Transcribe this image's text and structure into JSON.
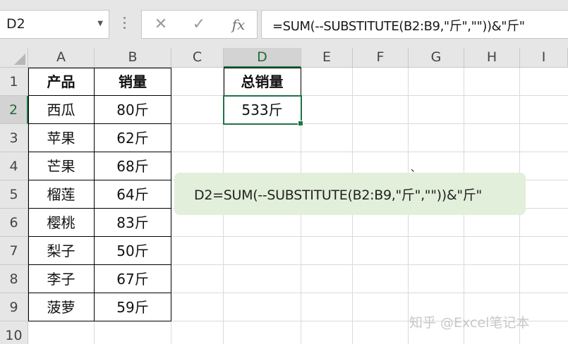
{
  "name_box": {
    "value": "D2",
    "dropdown_icon": "caret-down-icon"
  },
  "formula_bar": {
    "cancel_icon": "cross-icon",
    "enter_icon": "check-icon",
    "fx_label": "fx",
    "formula": "=SUM(--SUBSTITUTE(B2:B9,\"斤\",\"\"))&\"斤\""
  },
  "columns": [
    "A",
    "B",
    "C",
    "D",
    "E",
    "F",
    "G",
    "H",
    "I"
  ],
  "active_column": "D",
  "rows": [
    "1",
    "2",
    "3",
    "4",
    "5",
    "6",
    "7",
    "8",
    "9",
    "10"
  ],
  "active_row": "2",
  "table": {
    "headers": [
      "产品",
      "销量"
    ],
    "rows": [
      [
        "西瓜",
        "80斤"
      ],
      [
        "苹果",
        "62斤"
      ],
      [
        "芒果",
        "68斤"
      ],
      [
        "榴莲",
        "64斤"
      ],
      [
        "樱桃",
        "83斤"
      ],
      [
        "梨子",
        "50斤"
      ],
      [
        "李子",
        "67斤"
      ],
      [
        "菠萝",
        "59斤"
      ]
    ]
  },
  "summary": {
    "header": "总销量",
    "value": "533斤"
  },
  "callout": {
    "text": "D2=SUM(--SUBSTITUTE(B2:B9,\"斤\",\"\"))&\"斤\"",
    "background": "#e2efda"
  },
  "stray_mark": "、",
  "watermark": "知乎 @Excel笔记本",
  "colors": {
    "selection": "#217346",
    "header_bg": "#e6e6e6",
    "active_header_bg": "#d3d3d3"
  }
}
